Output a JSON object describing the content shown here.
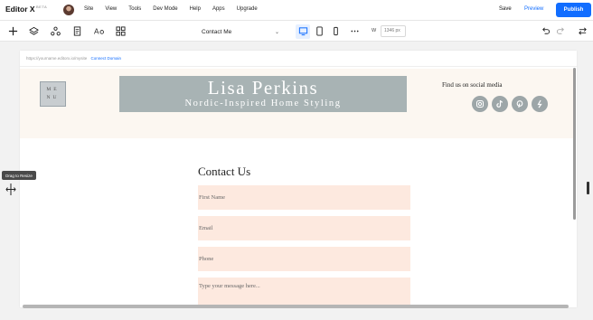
{
  "app": {
    "name": "Editor X",
    "badge": "BETA"
  },
  "menu": [
    "Site",
    "View",
    "Tools",
    "Dev Mode",
    "Help",
    "Apps",
    "Upgrade"
  ],
  "actions": {
    "save": "Save",
    "preview": "Preview",
    "publish": "Publish"
  },
  "toolbar": {
    "left_icons": [
      "add-icon",
      "layers-icon",
      "site-structure-icon",
      "pages-icon",
      "text-style-icon",
      "grid-icon"
    ],
    "page_selector": "Contact Me",
    "devices": [
      "desktop-icon",
      "tablet-icon",
      "mobile-icon",
      "more-icon"
    ],
    "width_label": "W",
    "width_value": "1346",
    "width_unit": "px",
    "right_icons": [
      "undo-icon",
      "redo-icon",
      "expand-icon"
    ]
  },
  "canvas": {
    "url": "https://yourname.editorx.io/mysite",
    "connect_domain": "Connect Domain",
    "site": {
      "menu_label_1": "ME",
      "menu_label_2": "NU",
      "title": "Lisa Perkins",
      "subtitle": "Nordic-Inspired Home Styling",
      "social_label": "Find us on social media",
      "social_icons": [
        "instagram-icon",
        "tiktok-icon",
        "pinterest-icon",
        "spotify-icon"
      ]
    },
    "contact": {
      "title": "Contact Us",
      "fields": [
        {
          "placeholder": "First Name"
        },
        {
          "placeholder": "Email"
        },
        {
          "placeholder": "Phone"
        },
        {
          "placeholder": "Type your message here..."
        }
      ]
    }
  },
  "tooltip": "Drag to Resize",
  "colors": {
    "accent": "#116dff",
    "header_bg": "#fcf7f1",
    "title_block": "#a8b3b4",
    "field_bg": "#fde9df"
  }
}
